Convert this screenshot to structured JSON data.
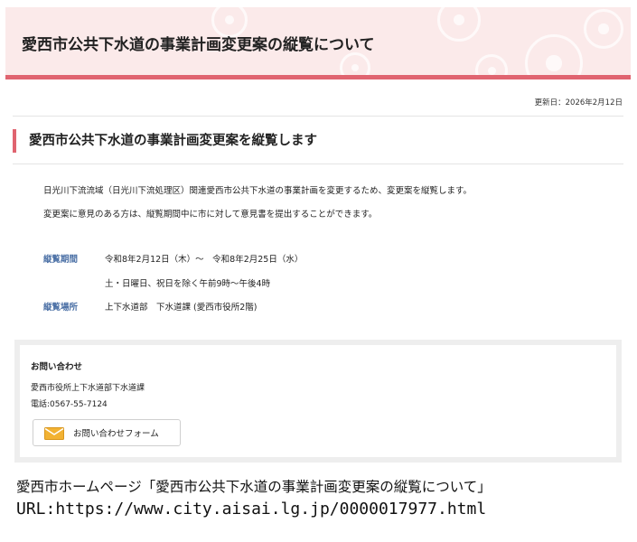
{
  "header": {
    "title": "愛西市公共下水道の事業計画変更案の縦覧について"
  },
  "updated": "更新日：2026年2月12日",
  "section": {
    "title": "愛西市公共下水道の事業計画変更案を縦覧します"
  },
  "intro": [
    "日光川下流流域（日光川下流処理区）関連愛西市公共下水道の事業計画を変更するため、変更案を縦覧します。",
    "変更案に意見のある方は、縦覧期間中に市に対して意見書を提出することができます。"
  ],
  "info": {
    "period_label": "縦覧期間",
    "period_value": "令和8年2月12日（木）～　令和8年2月25日（水）",
    "period_note": "土・日曜日、祝日を除く午前9時～午後4時",
    "place_label": "縦覧場所",
    "place_value": "上下水道部　下水道課 (愛西市役所2階)"
  },
  "contact": {
    "title": "お問い合わせ",
    "department": "愛西市役所上下水道部下水道課",
    "phone": "電話:0567-55-7124",
    "form_button_label": "お問い合わせフォーム",
    "icon": "mail-icon"
  },
  "caption": {
    "line1": "愛西市ホームページ「愛西市公共下水道の事業計画変更案の縦覧について」",
    "line2": "URL:https://www.city.aisai.lg.jp/0000017977.html"
  },
  "colors": {
    "accent": "#e06470",
    "header_bg": "#fbeaea",
    "label_blue": "#4a6fa5",
    "mail_icon": "#f2b233"
  }
}
